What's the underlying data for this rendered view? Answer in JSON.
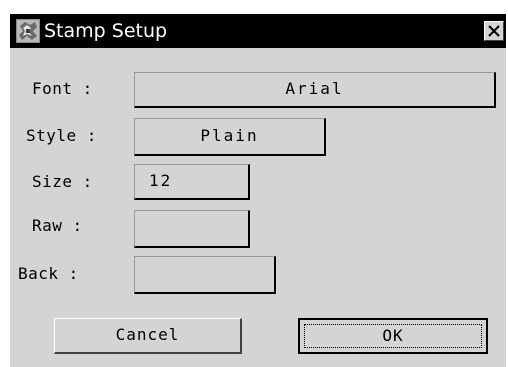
{
  "window": {
    "title": "Stamp Setup",
    "icon": "stamp-app-icon",
    "close_icon": "close-icon"
  },
  "form": {
    "font_label": "Font :",
    "font_value": "Arial",
    "style_label": "Style :",
    "style_value": "Plain",
    "size_label": "Size :",
    "size_value": "12",
    "raw_label": "Raw :",
    "raw_value": "",
    "back_label": "Back :",
    "back_value": ""
  },
  "buttons": {
    "cancel_label": "Cancel",
    "ok_label": "OK"
  },
  "colors": {
    "titlebar": "#000000",
    "title_text": "#ffffff",
    "dialog_bg": "#d4d4d4"
  }
}
